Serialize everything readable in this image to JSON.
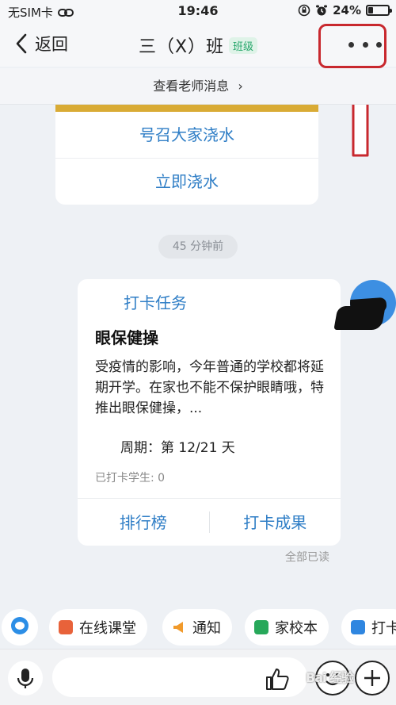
{
  "status_bar": {
    "carrier": "无SIM卡",
    "time": "19:46",
    "battery": "24%",
    "battery_level": 0.24
  },
  "nav": {
    "back_label": "返回",
    "title": "三（X）班",
    "badge": "班级"
  },
  "teacher_messages": {
    "label": "查看老师消息"
  },
  "top_card": {
    "actions": [
      "号召大家浇水",
      "立即浇水"
    ]
  },
  "timestamp": "45 分钟前",
  "task_card": {
    "header": "打卡任务",
    "title": "眼保健操",
    "description": "受疫情的影响，今年普通的学校都将延期开学。在家也不能不保护眼睛哦，特推出眼保健操，...",
    "period": "周期：第 12/21 天",
    "checked_in": "已打卡学生: 0",
    "action_left": "排行榜",
    "action_right": "打卡成果"
  },
  "read_status": "全部已读",
  "quick_actions": [
    {
      "label": "在线课堂",
      "icon": "online-class-icon",
      "color": "#e8623a"
    },
    {
      "label": "通知",
      "icon": "megaphone-icon",
      "color": "#f19a2b"
    },
    {
      "label": "家校本",
      "icon": "notebook-icon",
      "color": "#27a85a"
    },
    {
      "label": "打卡",
      "icon": "calendar-check-icon",
      "color": "#2f86e0"
    }
  ],
  "colors": {
    "accent_blue": "#2f7ec6",
    "gold_stripe": "#d9ab35",
    "badge_green": "#26a66b",
    "annotation_red": "#c8282e"
  },
  "watermark": "Bai 经验"
}
